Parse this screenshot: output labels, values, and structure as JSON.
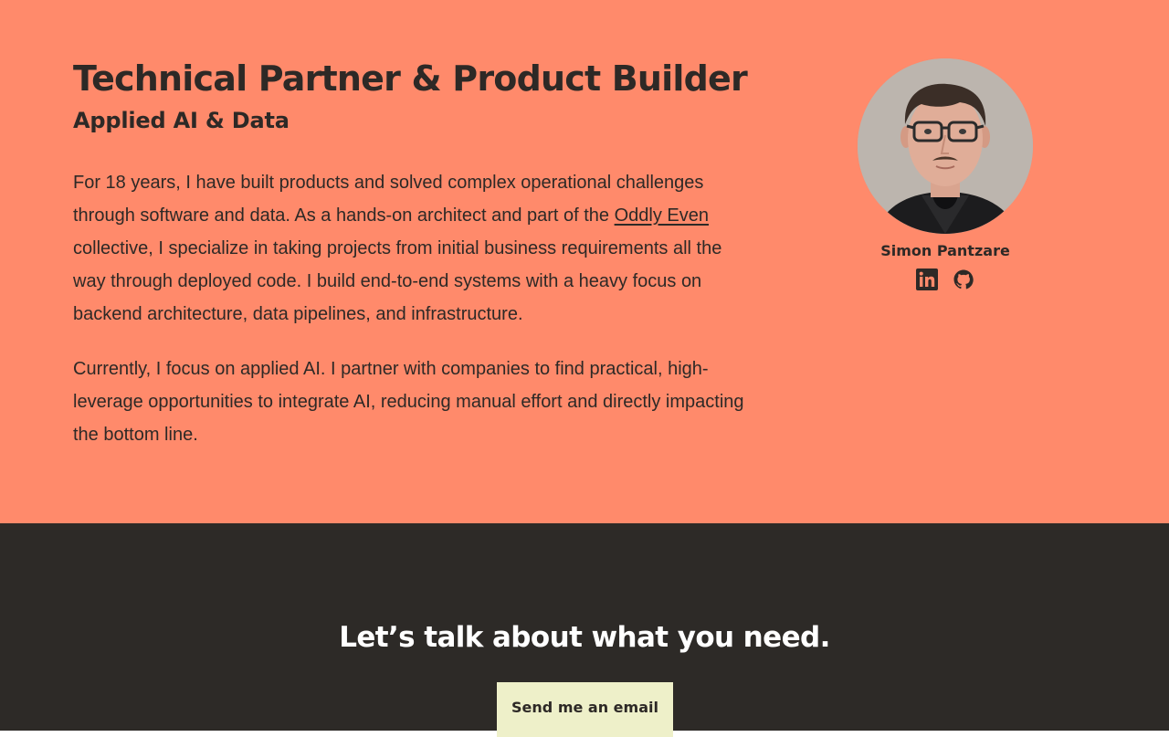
{
  "hero": {
    "headline": "Technical Partner & Product Builder",
    "subheadline": "Applied AI & Data",
    "paragraph1_before_link": "For 18 years, I have built products and solved complex operational challenges through software and data. As a hands-on architect and part of the ",
    "paragraph1_link": "Oddly Even",
    "paragraph1_after_link": " collective, I specialize in taking projects from initial business requirements all the way through deployed code. I build end-to-end systems with a heavy focus on backend architecture, data pipelines, and infrastructure.",
    "paragraph2": "Currently, I focus on applied AI. I partner with companies to find practical, high-leverage opportunities to integrate AI, reducing manual effort and directly impacting the bottom line."
  },
  "profile": {
    "name": "Simon Pantzare",
    "socials": [
      {
        "icon": "linkedin-icon"
      },
      {
        "icon": "github-icon"
      }
    ]
  },
  "contact": {
    "title": "Let’s talk about what you need.",
    "button_label": "Send me an email"
  },
  "colors": {
    "hero_background": "#ff8a6b",
    "text_dark": "#2d2926",
    "contact_background": "#2d2a27",
    "button_background": "#eef0c9",
    "contact_title": "#ffffff"
  }
}
